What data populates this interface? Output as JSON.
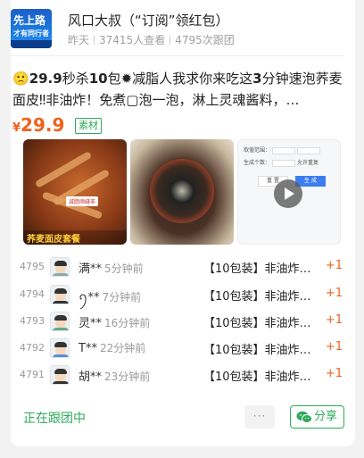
{
  "header": {
    "avatar_line1": "先上路",
    "avatar_line2": "才有同行者",
    "name": "风口大叔（“订阅”领红包）",
    "time": "昨天",
    "views": "37415人查看",
    "follows": "4795次跟团"
  },
  "product": {
    "title_parts": [
      "🙁",
      "29.9",
      "秒杀",
      "10",
      "包✹减脂人我求你来吃这",
      "3",
      "分钟速泡荞麦面皮‼非油炸！免煮▢泡一泡，淋上灵魂酱料，…"
    ],
    "price_symbol": "¥",
    "price": "29.9",
    "tag": "素材",
    "img1_caption": "荞麦面皮套餐",
    "img1_label": "减脂顺缝非",
    "img3_rows": [
      "取值范围：",
      "生成个数："
    ],
    "img3_toggle": "允许重复",
    "img3_btn_reset": "重 置",
    "img3_btn_generate": "生 成"
  },
  "orders": [
    {
      "id": "4795",
      "name": "满**",
      "time": "5分钟前",
      "product": "【10包装】非油炸…",
      "qty": "+1"
    },
    {
      "id": "4794",
      "name": "ꪆ**",
      "time": "7分钟前",
      "product": "【10包装】非油炸…",
      "qty": "+1"
    },
    {
      "id": "4793",
      "name": "灵**",
      "time": "16分钟前",
      "product": "【10包装】非油炸…",
      "qty": "+1"
    },
    {
      "id": "4792",
      "name": "T**",
      "time": "22分钟前",
      "product": "【10包装】非油炸…",
      "qty": "+1"
    },
    {
      "id": "4791",
      "name": "胡**",
      "time": "23分钟前",
      "product": "【10包装】非油炸…",
      "qty": "+1"
    }
  ],
  "footer": {
    "status": "正在跟团中",
    "more": "···",
    "share": "分享"
  },
  "colors": {
    "accent_green": "#2daa5a",
    "price_orange": "#f0611e"
  }
}
